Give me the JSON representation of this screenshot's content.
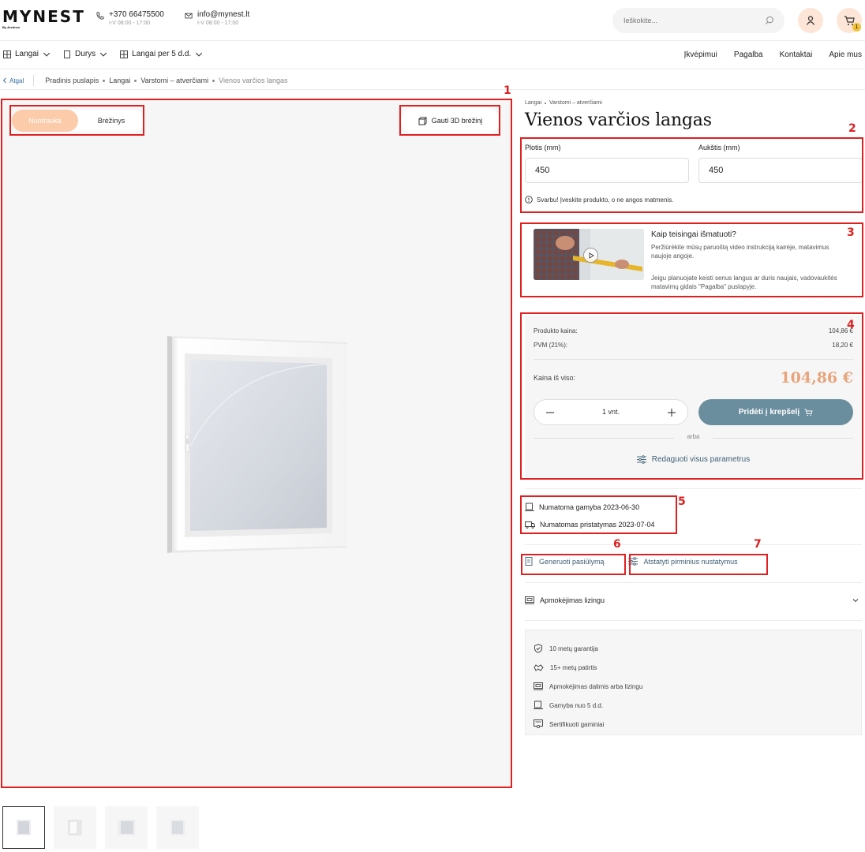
{
  "header": {
    "logo": "MYNEST",
    "logo_sub": "By Arednes",
    "phone": "+370 66475500",
    "phone_hours": "I-V 08:00 - 17:00",
    "email": "info@mynest.lt",
    "email_hours": "I-V 08:00 - 17:00",
    "search_placeholder": "Ieškokite...",
    "cart_count": "1"
  },
  "nav": {
    "left": [
      "Langai",
      "Durys",
      "Langai per 5 d.d."
    ],
    "right": [
      "Įkvėpimui",
      "Pagalba",
      "Kontaktai",
      "Apie mus"
    ]
  },
  "breadcrumb": {
    "back": "Atgal",
    "items": [
      "Pradinis puslapis",
      "Langai",
      "Varstomi – atverčiami",
      "Vienos varčios langas"
    ]
  },
  "gallery": {
    "tab_photo": "Nuotrauka",
    "tab_drawing": "Brėžinys",
    "btn_3d": "Gauti 3D brėžinį"
  },
  "product": {
    "crumbs": [
      "Langai",
      "Varstomi – atverčiami"
    ],
    "title": "Vienos varčios langas",
    "width_label": "Plotis (mm)",
    "width_value": "450",
    "height_label": "Aukštis (mm)",
    "height_value": "450",
    "warning": "Svarbu! Įveskite produkto, o ne angos matmenis."
  },
  "video": {
    "title": "Kaip teisingai išmatuoti?",
    "text1": "Peržiūrėkite mūsų paruoštą video instrukciją kairėje, matavimus naujoje angoje.",
    "text2": "Jeigu planuojate keisti senus langus ar duris naujais, vadovaukitės matavimų gidais \"Pagalba\" puslapyje."
  },
  "price": {
    "product_label": "Produkto kaina:",
    "product_value": "104,86 €",
    "vat_label": "PVM (21%):",
    "vat_value": "18,20 €",
    "total_label": "Kaina iš viso:",
    "total_value": "104,86 €",
    "qty": "1 vnt.",
    "add_btn": "Pridėti į krepšelį",
    "or": "arba",
    "edit_all": "Redaguoti visus parametrus"
  },
  "dates": {
    "production": "Numatoma gamyba 2023-06-30",
    "delivery": "Numatomas pristatymas 2023-07-04"
  },
  "actions": {
    "generate": "Generuoti pasiūlymą",
    "reset": "Atstatyti pirminius nustatymus"
  },
  "leasing": "Apmokėjimas lizingu",
  "features": [
    "10 metų garantija",
    "15+ metų patirtis",
    "Apmokėjimas dalimis arba lizingu",
    "Gamyba nuo 5 d.d.",
    "Sertifikuoti gaminiai"
  ],
  "annotations": [
    "1",
    "2",
    "3",
    "4",
    "5",
    "6",
    "7"
  ],
  "colors": {
    "accent": "#fccba9",
    "price": "#e8a47c",
    "primary_btn": "#6b8e9e",
    "annotation": "#e02020"
  }
}
